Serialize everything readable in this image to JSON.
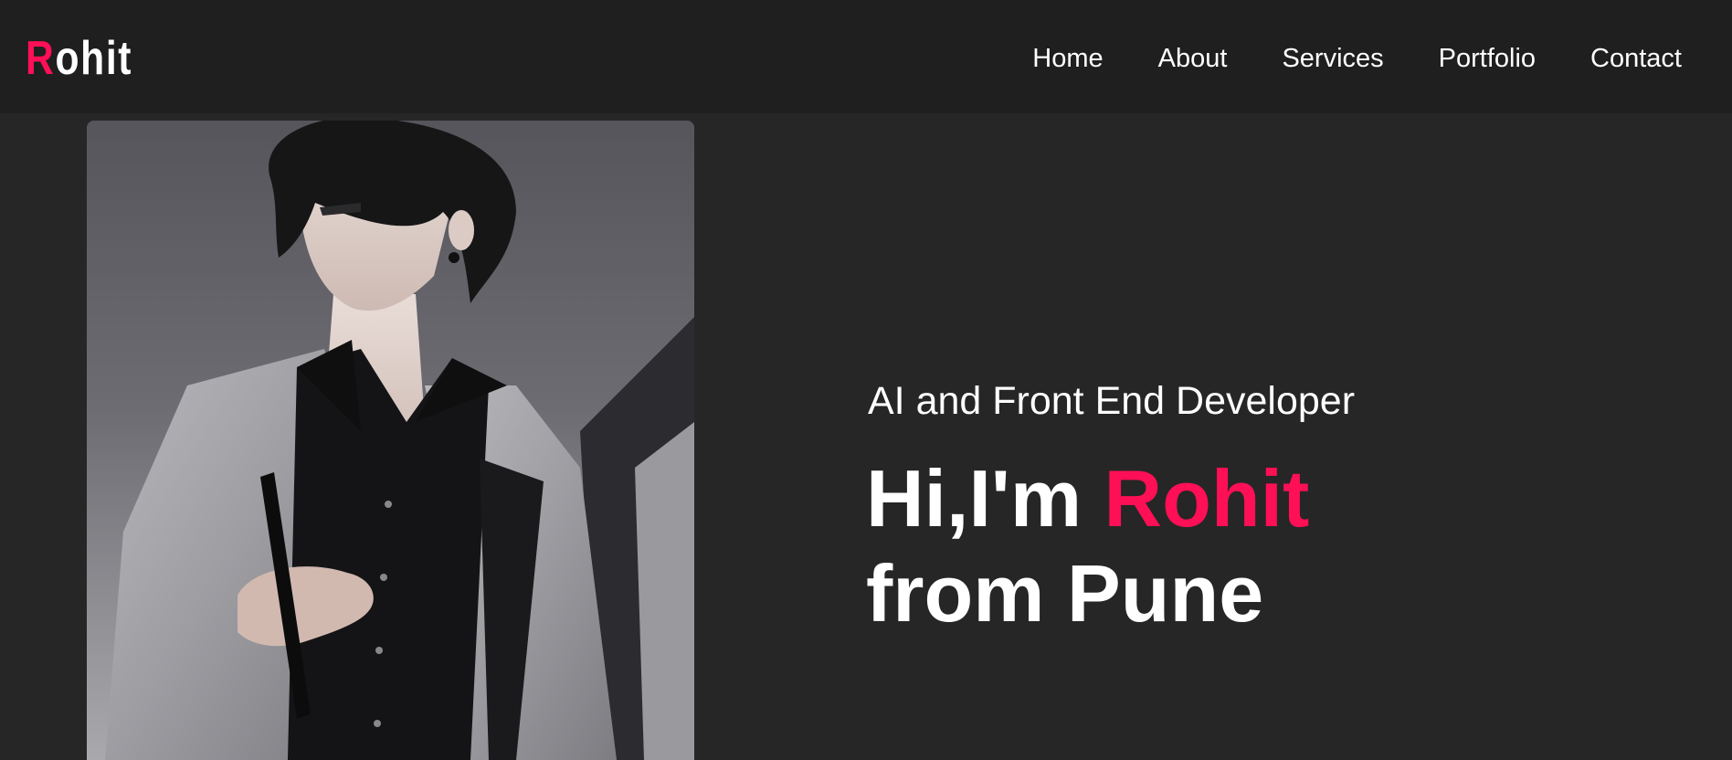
{
  "brand": {
    "logo_first": "R",
    "logo_rest": "ohit",
    "accent_color": "#ff0f56"
  },
  "nav": {
    "items": [
      {
        "label": "Home"
      },
      {
        "label": "About"
      },
      {
        "label": "Services"
      },
      {
        "label": "Portfolio"
      },
      {
        "label": "Contact"
      }
    ]
  },
  "hero": {
    "image_subject": "anime-man-portrait",
    "subtitle": "AI and Front End Developer",
    "greeting": "Hi,I'm",
    "name": "Rohit",
    "location_line": "from Pune"
  },
  "colors": {
    "background": "#262626",
    "navbar": "#1f1f1f",
    "text": "#ffffff"
  }
}
